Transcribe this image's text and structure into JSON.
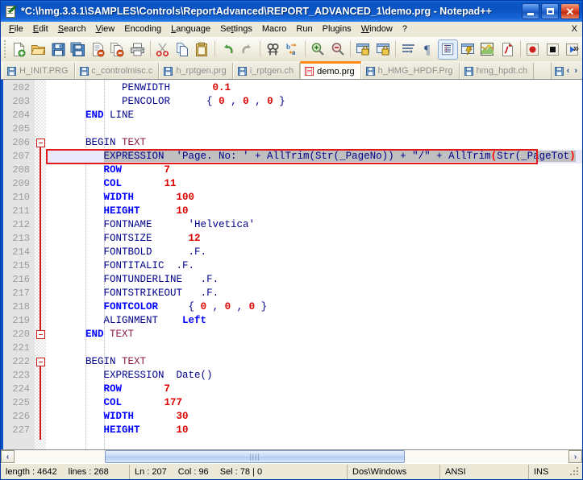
{
  "window": {
    "title": "*C:\\hmg.3.3.1\\SAMPLES\\Controls\\ReportAdvanced\\REPORT_ADVANCED_1\\demo.prg - Notepad++",
    "icon": "notepad-plus-plus-icon",
    "minimize_label": "_",
    "maximize_label": "□",
    "close_label": "✕"
  },
  "menubar": {
    "items": [
      {
        "label": "File",
        "accel": "F"
      },
      {
        "label": "Edit",
        "accel": "E"
      },
      {
        "label": "Search",
        "accel": "S"
      },
      {
        "label": "View",
        "accel": "V"
      },
      {
        "label": "Encoding",
        "accel": ""
      },
      {
        "label": "Language",
        "accel": "L"
      },
      {
        "label": "Settings",
        "accel": "t"
      },
      {
        "label": "Macro",
        "accel": ""
      },
      {
        "label": "Run",
        "accel": ""
      },
      {
        "label": "Plugins",
        "accel": ""
      },
      {
        "label": "Window",
        "accel": "W"
      },
      {
        "label": "?",
        "accel": ""
      }
    ],
    "right_label": "X"
  },
  "toolbar": {
    "overflow_label": "»",
    "buttons": [
      {
        "name": "new-file-icon",
        "tip": "New"
      },
      {
        "name": "open-file-icon",
        "tip": "Open"
      },
      {
        "name": "save-icon",
        "tip": "Save"
      },
      {
        "name": "save-all-icon",
        "tip": "Save All"
      },
      {
        "name": "close-file-icon",
        "tip": "Close"
      },
      {
        "name": "close-all-icon",
        "tip": "Close All"
      },
      {
        "name": "print-icon",
        "tip": "Print"
      },
      {
        "name": "cut-icon",
        "tip": "Cut"
      },
      {
        "name": "copy-icon",
        "tip": "Copy"
      },
      {
        "name": "paste-icon",
        "tip": "Paste"
      },
      {
        "name": "undo-icon",
        "tip": "Undo"
      },
      {
        "name": "redo-icon",
        "tip": "Redo"
      },
      {
        "name": "find-icon",
        "tip": "Find"
      },
      {
        "name": "replace-icon",
        "tip": "Replace"
      },
      {
        "name": "zoom-in-icon",
        "tip": "Zoom In"
      },
      {
        "name": "zoom-out-icon",
        "tip": "Zoom Out"
      },
      {
        "name": "sync-vertical-icon",
        "tip": "Synchronize Vertical Scrolling"
      },
      {
        "name": "sync-horizontal-icon",
        "tip": "Synchronize Horizontal Scrolling"
      },
      {
        "name": "word-wrap-icon",
        "tip": "Word Wrap"
      },
      {
        "name": "show-all-chars-icon",
        "tip": "Show All Characters"
      },
      {
        "name": "indent-guide-icon",
        "tip": "Show Indent Guide"
      },
      {
        "name": "user-define-dialog-icon",
        "tip": "User Defined Dialogue"
      },
      {
        "name": "doc-map-icon",
        "tip": "Document Map"
      },
      {
        "name": "function-list-icon",
        "tip": "Function List"
      },
      {
        "name": "record-macro-icon",
        "tip": "Start Recording"
      },
      {
        "name": "stop-macro-icon",
        "tip": "Stop Recording"
      },
      {
        "name": "play-macro-icon",
        "tip": "Playback"
      }
    ]
  },
  "tabs": [
    {
      "label": "H_INIT.PRG",
      "active": false,
      "modified": false
    },
    {
      "label": "c_controlmisc.c",
      "active": false,
      "modified": false
    },
    {
      "label": "h_rptgen.prg",
      "active": false,
      "modified": false
    },
    {
      "label": "i_rptgen.ch",
      "active": false,
      "modified": false
    },
    {
      "label": "demo.prg",
      "active": true,
      "modified": true
    },
    {
      "label": "h_HMG_HPDF.Prg",
      "active": false,
      "modified": false
    },
    {
      "label": "hmg_hpdt.ch",
      "active": false,
      "modified": false
    }
  ],
  "tab_nav": {
    "prev": "‹",
    "next": "›"
  },
  "editor": {
    "first_line": 202,
    "current_line": 207,
    "lines": [
      {
        "n": 202,
        "tokens": [
          {
            "t": "            ",
            "c": "plain"
          },
          {
            "t": "PENWIDTH",
            "c": "kw"
          },
          {
            "t": "       ",
            "c": "plain"
          },
          {
            "t": "0.1",
            "c": "num"
          }
        ]
      },
      {
        "n": 203,
        "tokens": [
          {
            "t": "            ",
            "c": "plain"
          },
          {
            "t": "PENCOLOR",
            "c": "kw"
          },
          {
            "t": "      ",
            "c": "plain"
          },
          {
            "t": "{ ",
            "c": "brace"
          },
          {
            "t": "0",
            "c": "num"
          },
          {
            "t": " , ",
            "c": "brace"
          },
          {
            "t": "0",
            "c": "num"
          },
          {
            "t": " , ",
            "c": "brace"
          },
          {
            "t": "0",
            "c": "num"
          },
          {
            "t": " }",
            "c": "brace"
          }
        ]
      },
      {
        "n": 204,
        "tokens": [
          {
            "t": "      ",
            "c": "plain"
          },
          {
            "t": "END",
            "c": "kw-b"
          },
          {
            "t": " ",
            "c": "plain"
          },
          {
            "t": "LINE",
            "c": "kw"
          }
        ]
      },
      {
        "n": 205,
        "tokens": []
      },
      {
        "n": 206,
        "tokens": [
          {
            "t": "      ",
            "c": "plain"
          },
          {
            "t": "BEGIN",
            "c": "kw"
          },
          {
            "t": " ",
            "c": "plain"
          },
          {
            "t": "TEXT",
            "c": "typ"
          }
        ]
      },
      {
        "n": 207,
        "tokens": [
          {
            "t": "         ",
            "c": "plain"
          },
          {
            "t": "EXPRESSION  'Page. No: ' + AllTrim(Str(_PageNo)) + \"/\" + AllTrim",
            "c": "sel-kw"
          },
          {
            "t": "(",
            "c": "sel-brace"
          },
          {
            "t": "Str(_PageTot",
            "c": "sel-kw"
          },
          {
            "t": ")",
            "c": "sel-brace"
          }
        ]
      },
      {
        "n": 208,
        "tokens": [
          {
            "t": "         ",
            "c": "plain"
          },
          {
            "t": "ROW",
            "c": "kw-b"
          },
          {
            "t": "       ",
            "c": "plain"
          },
          {
            "t": "7",
            "c": "num"
          }
        ]
      },
      {
        "n": 209,
        "tokens": [
          {
            "t": "         ",
            "c": "plain"
          },
          {
            "t": "COL",
            "c": "kw-b"
          },
          {
            "t": "       ",
            "c": "plain"
          },
          {
            "t": "11",
            "c": "num"
          }
        ]
      },
      {
        "n": 210,
        "tokens": [
          {
            "t": "         ",
            "c": "plain"
          },
          {
            "t": "WIDTH",
            "c": "kw-b"
          },
          {
            "t": "       ",
            "c": "plain"
          },
          {
            "t": "100",
            "c": "num"
          }
        ]
      },
      {
        "n": 211,
        "tokens": [
          {
            "t": "         ",
            "c": "plain"
          },
          {
            "t": "HEIGHT",
            "c": "kw-b"
          },
          {
            "t": "      ",
            "c": "plain"
          },
          {
            "t": "10",
            "c": "num"
          }
        ]
      },
      {
        "n": 212,
        "tokens": [
          {
            "t": "         ",
            "c": "plain"
          },
          {
            "t": "FONTNAME",
            "c": "kw"
          },
          {
            "t": "      ",
            "c": "plain"
          },
          {
            "t": "'Helvetica'",
            "c": "kw"
          }
        ]
      },
      {
        "n": 213,
        "tokens": [
          {
            "t": "         ",
            "c": "plain"
          },
          {
            "t": "FONTSIZE",
            "c": "kw"
          },
          {
            "t": "      ",
            "c": "plain"
          },
          {
            "t": "12",
            "c": "num"
          }
        ]
      },
      {
        "n": 214,
        "tokens": [
          {
            "t": "         ",
            "c": "plain"
          },
          {
            "t": "FONTBOLD",
            "c": "kw"
          },
          {
            "t": "      ",
            "c": "plain"
          },
          {
            "t": ".F.",
            "c": "kw"
          }
        ]
      },
      {
        "n": 215,
        "tokens": [
          {
            "t": "         ",
            "c": "plain"
          },
          {
            "t": "FONTITALIC",
            "c": "kw"
          },
          {
            "t": "  ",
            "c": "plain"
          },
          {
            "t": ".F.",
            "c": "kw"
          }
        ]
      },
      {
        "n": 216,
        "tokens": [
          {
            "t": "         ",
            "c": "plain"
          },
          {
            "t": "FONTUNDERLINE",
            "c": "kw"
          },
          {
            "t": "   ",
            "c": "plain"
          },
          {
            "t": ".F.",
            "c": "kw"
          }
        ]
      },
      {
        "n": 217,
        "tokens": [
          {
            "t": "         ",
            "c": "plain"
          },
          {
            "t": "FONTSTRIKEOUT",
            "c": "kw"
          },
          {
            "t": "   ",
            "c": "plain"
          },
          {
            "t": ".F.",
            "c": "kw"
          }
        ]
      },
      {
        "n": 218,
        "tokens": [
          {
            "t": "         ",
            "c": "plain"
          },
          {
            "t": "FONTCOLOR",
            "c": "kw-b"
          },
          {
            "t": "     ",
            "c": "plain"
          },
          {
            "t": "{ ",
            "c": "brace"
          },
          {
            "t": "0",
            "c": "num"
          },
          {
            "t": " , ",
            "c": "brace"
          },
          {
            "t": "0",
            "c": "num"
          },
          {
            "t": " , ",
            "c": "brace"
          },
          {
            "t": "0",
            "c": "num"
          },
          {
            "t": " }",
            "c": "brace"
          }
        ]
      },
      {
        "n": 219,
        "tokens": [
          {
            "t": "         ",
            "c": "plain"
          },
          {
            "t": "ALIGNMENT",
            "c": "kw"
          },
          {
            "t": "    ",
            "c": "plain"
          },
          {
            "t": "Left",
            "c": "kw-b"
          }
        ]
      },
      {
        "n": 220,
        "tokens": [
          {
            "t": "      ",
            "c": "plain"
          },
          {
            "t": "END",
            "c": "kw-b"
          },
          {
            "t": " ",
            "c": "plain"
          },
          {
            "t": "TEXT",
            "c": "typ"
          }
        ]
      },
      {
        "n": 221,
        "tokens": []
      },
      {
        "n": 222,
        "tokens": [
          {
            "t": "      ",
            "c": "plain"
          },
          {
            "t": "BEGIN",
            "c": "kw"
          },
          {
            "t": " ",
            "c": "plain"
          },
          {
            "t": "TEXT",
            "c": "typ"
          }
        ]
      },
      {
        "n": 223,
        "tokens": [
          {
            "t": "         ",
            "c": "plain"
          },
          {
            "t": "EXPRESSION  Date()",
            "c": "kw"
          }
        ]
      },
      {
        "n": 224,
        "tokens": [
          {
            "t": "         ",
            "c": "plain"
          },
          {
            "t": "ROW",
            "c": "kw-b"
          },
          {
            "t": "       ",
            "c": "plain"
          },
          {
            "t": "7",
            "c": "num"
          }
        ]
      },
      {
        "n": 225,
        "tokens": [
          {
            "t": "         ",
            "c": "plain"
          },
          {
            "t": "COL",
            "c": "kw-b"
          },
          {
            "t": "       ",
            "c": "plain"
          },
          {
            "t": "177",
            "c": "num"
          }
        ]
      },
      {
        "n": 226,
        "tokens": [
          {
            "t": "         ",
            "c": "plain"
          },
          {
            "t": "WIDTH",
            "c": "kw-b"
          },
          {
            "t": "       ",
            "c": "plain"
          },
          {
            "t": "30",
            "c": "num"
          }
        ]
      },
      {
        "n": 227,
        "tokens": [
          {
            "t": "         ",
            "c": "plain"
          },
          {
            "t": "HEIGHT",
            "c": "kw-b"
          },
          {
            "t": "      ",
            "c": "plain"
          },
          {
            "t": "10",
            "c": "num"
          }
        ]
      }
    ]
  },
  "statusbar": {
    "length_label": "length : 4642",
    "lines_label": "lines : 268",
    "ln_label": "Ln : 207",
    "col_label": "Col : 96",
    "sel_label": "Sel : 78 | 0",
    "eol_label": "Dos\\Windows",
    "encoding_label": "ANSI",
    "insert_label": "INS"
  },
  "scrollbar": {
    "left_arrow": "‹",
    "right_arrow": "›",
    "grip": "||||"
  },
  "colors": {
    "title_blue": "#0a55c6",
    "accent_orange": "#ff8c1a",
    "keyword_navy": "#00008b",
    "keyword_blue": "#0000ff",
    "number_red": "#dd0000",
    "type_maroon": "#8b1a4a",
    "highlight_red": "#e11b1b",
    "selection_grey": "#c0c0c0",
    "current_line": "#e8eafc"
  }
}
